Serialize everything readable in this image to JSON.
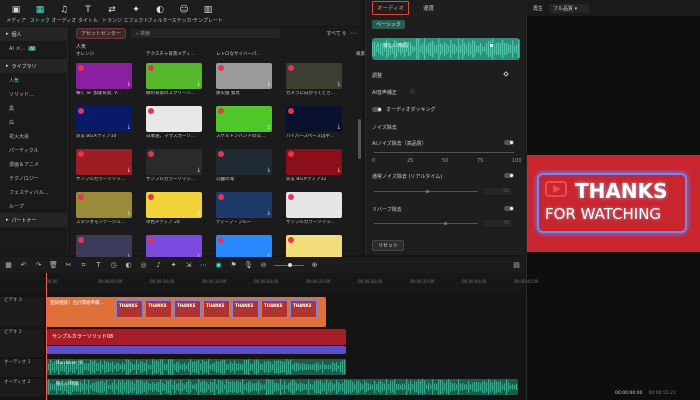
{
  "toolbar": {
    "items": [
      {
        "label": "メディア",
        "icon": "media-icon"
      },
      {
        "label": "ストック",
        "icon": "stock-icon",
        "active": true
      },
      {
        "label": "オーディオ",
        "icon": "audio-icon"
      },
      {
        "label": "タイトル",
        "icon": "title-icon"
      },
      {
        "label": "トランジ",
        "icon": "transition-icon"
      },
      {
        "label": "エフェクト",
        "icon": "effect-icon"
      },
      {
        "label": "フィルター",
        "icon": "filter-icon"
      },
      {
        "label": "ステッカー",
        "icon": "sticker-icon"
      },
      {
        "label": "テンプレート",
        "icon": "template-icon"
      }
    ]
  },
  "sidebar": {
    "items": [
      {
        "label": "個人",
        "type": "head"
      },
      {
        "label": "AI メ...",
        "type": "item",
        "badge": "AI"
      },
      {
        "label": "ライブラリ",
        "type": "head"
      },
      {
        "label": "人気",
        "type": "item",
        "active": true
      },
      {
        "label": "ソリッド...",
        "type": "item"
      },
      {
        "label": "黒",
        "type": "item"
      },
      {
        "label": "白",
        "type": "item"
      },
      {
        "label": "花火大会",
        "type": "item"
      },
      {
        "label": "パーティクル",
        "type": "item"
      },
      {
        "label": "漫画＆アニメ",
        "type": "item"
      },
      {
        "label": "テクノロジー",
        "type": "item"
      },
      {
        "label": "フェスティバル...",
        "type": "item"
      },
      {
        "label": "ループ",
        "type": "item"
      },
      {
        "label": "パートナー",
        "type": "head"
      }
    ]
  },
  "media": {
    "center_label": "アセットセンター",
    "search_placeholder": "検索",
    "filter_label": "すべて",
    "section_label": "人気",
    "top_captions": [
      "オレンジ",
      "テクスチャ背景メディ...",
      "レトロなサイバーパ...",
      "",
      "風景背景メディア 03"
    ],
    "tiles": [
      {
        "caption": "横く SF 加速背景, V...",
        "color": "#8a1fa0"
      },
      {
        "caption": "緑の背景のスクリーン...",
        "color": "#56b92b"
      },
      {
        "caption": "防火服 緊急",
        "color": "#9a9a9a"
      },
      {
        "caption": "カメラに向かってとき...",
        "color": "#3b3f33"
      },
      {
        "caption": "炎＆ BGメディア10",
        "color": "#0a1a6a"
      },
      {
        "caption": "日本語、マウスカーソ...",
        "color": "#e8e8e8"
      },
      {
        "caption": "スケルトンハンドの公...",
        "color": "#4fc72a"
      },
      {
        "caption": "ハイパースペースは宇...",
        "color": "#0a1030"
      },
      {
        "caption": "サンプルカラーソリッ...",
        "color": "#9c1e24"
      },
      {
        "caption": "サンプルカラーソリッ...",
        "color": "#2a2a2a"
      },
      {
        "caption": "公園の滝",
        "color": "#1f2a33"
      },
      {
        "caption": "炎＆ BGメディア12",
        "color": "#8a0f1a"
      },
      {
        "caption": "スタジオモンテージュ...",
        "color": "#9a8a3a"
      },
      {
        "caption": "単色メディア 24",
        "color": "#f2d43a"
      },
      {
        "caption": "ディープ・ブルー",
        "color": "#1e3a6a"
      },
      {
        "caption": "サンプルカラーソリッ...",
        "color": "#e6e6e6"
      },
      {
        "caption": "",
        "color": "#3a3a5a"
      },
      {
        "caption": "",
        "color": "#7a4adf"
      },
      {
        "caption": "",
        "color": "#2a88ff"
      },
      {
        "caption": "",
        "color": "#f1dd7a"
      }
    ]
  },
  "audio_panel": {
    "tab_audio": "オーディオ",
    "tab_speed": "速度",
    "basic_label": "ベーシック",
    "clip_name": "楽しい時間",
    "adjust_label": "調整",
    "ai_voice_label": "AI音声補正",
    "ducking_label": "オーディオダッキング",
    "noise_label": "ノイズ除去",
    "ai_noise_label": "AIノイズ除去（高品質）",
    "ticks": [
      "0",
      "25",
      "50",
      "75",
      "100"
    ],
    "normal_noise_label": "通常ノイズ除去 (リアルタイム)",
    "normal_noise_value": "50",
    "reverb_label": "リバーブ除去",
    "reverb_value": "70",
    "reset_label": "リセット"
  },
  "preview": {
    "tab_play": "再生",
    "quality": "フル品質",
    "time_current": "00:00:00:00",
    "time_total": "00:00:55:21",
    "thanks_line1": "THANKS",
    "thanks_line2": "FOR WATCHING"
  },
  "timeline": {
    "ruler_ticks": [
      "00:00",
      "00:00:05:00",
      "00:00:10:00",
      "00:00:15:00",
      "00:00:20:00",
      "00:00:25:00",
      "00:00:30:00",
      "00:00:35:00",
      "00:00:40:00",
      "00:00:45:00"
    ],
    "tracks": [
      {
        "name": "ビデオ 3"
      },
      {
        "name": "ビデオ 2"
      },
      {
        "name": "ビデオ 1"
      },
      {
        "name": "オーディオ 1"
      },
      {
        "name": "オーディオ 2"
      }
    ],
    "clips": {
      "title_clip": "登録相談！合計開始準備...",
      "thanks_clip": "THANKS",
      "solid_clip": "サンプルカラーソリッド08",
      "narration_clip": "Narration_0...",
      "music_clip": "楽しい時間"
    },
    "accent_color": "#e2453a",
    "audio_color": "#3aa88a"
  }
}
